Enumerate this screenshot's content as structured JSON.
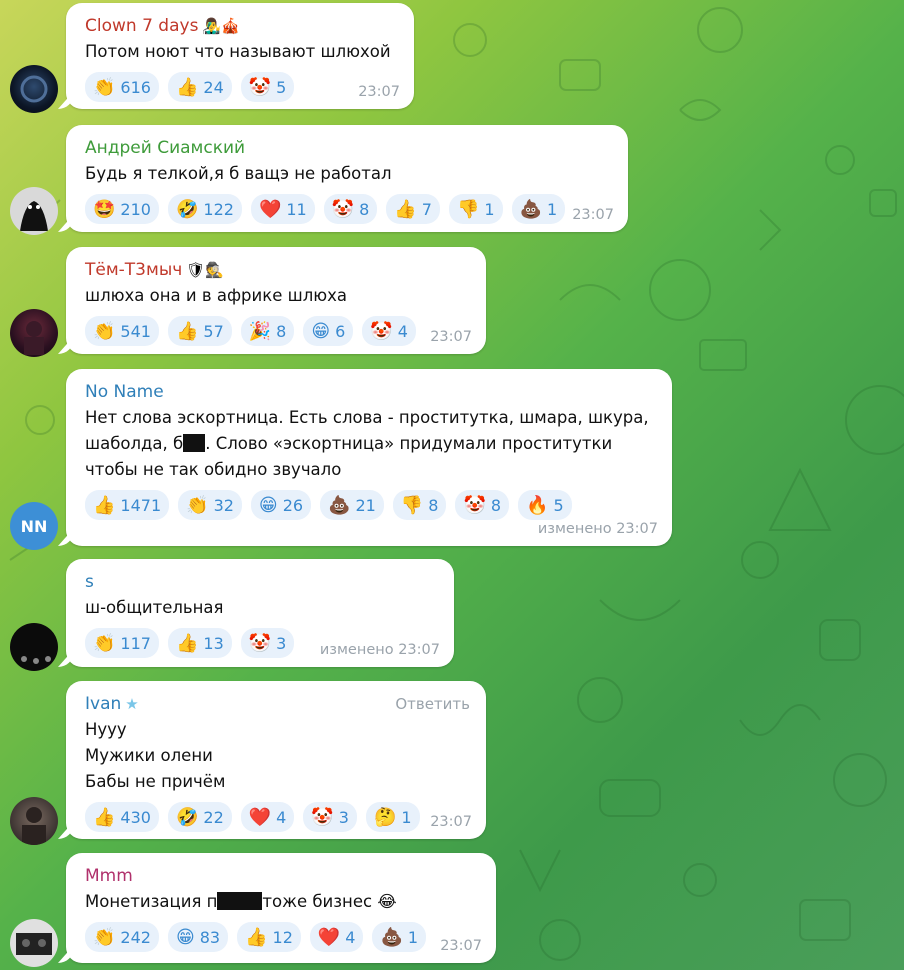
{
  "messages": [
    {
      "name": "Clown 7 days",
      "name_color": "#c0392b",
      "badge": "👨‍🎤🎪",
      "lines": [
        "Потом ноют что называют шлюхой"
      ],
      "reactions": [
        {
          "emoji": "👏",
          "count": "616"
        },
        {
          "emoji": "👍",
          "count": "24"
        },
        {
          "emoji": "🤡",
          "count": "5"
        }
      ],
      "time": "23:07"
    },
    {
      "name": "Андрей Сиамский",
      "name_color": "#3e9b3a",
      "lines": [
        "Будь я телкой,я б ващэ не работал"
      ],
      "reactions": [
        {
          "emoji": "🤩",
          "count": "210"
        },
        {
          "emoji": "🤣",
          "count": "122"
        },
        {
          "emoji": "❤️",
          "count": "11"
        },
        {
          "emoji": "🤡",
          "count": "8"
        },
        {
          "emoji": "👍",
          "count": "7"
        },
        {
          "emoji": "👎",
          "count": "1"
        },
        {
          "emoji": "💩",
          "count": "1"
        }
      ],
      "time": "23:07"
    },
    {
      "name": "Тём-Т3мыч",
      "name_color": "#c0392b",
      "badge": "🛡🕵",
      "lines": [
        "шлюха она и в африке шлюха"
      ],
      "reactions": [
        {
          "emoji": "👏",
          "count": "541"
        },
        {
          "emoji": "👍",
          "count": "57"
        },
        {
          "emoji": "🎉",
          "count": "8"
        },
        {
          "emoji": "😁",
          "count": "6"
        },
        {
          "emoji": "🤡",
          "count": "4"
        }
      ],
      "time": "23:07"
    },
    {
      "name": "No Name",
      "name_color": "#2f7fb8",
      "line1": "Нет слова эскортница. Есть слова - проститутка, шмара, шкура,",
      "line2_a": "шаболда, б",
      "line2_b": ". Слово «эскортница» придумали проститутки",
      "line3": "чтобы не так обидно звучало",
      "reactions": [
        {
          "emoji": "👍",
          "count": "1471"
        },
        {
          "emoji": "👏",
          "count": "32"
        },
        {
          "emoji": "😁",
          "count": "26"
        },
        {
          "emoji": "💩",
          "count": "21"
        },
        {
          "emoji": "👎",
          "count": "8"
        },
        {
          "emoji": "🤡",
          "count": "8"
        },
        {
          "emoji": "🔥",
          "count": "5"
        }
      ],
      "time": "изменено 23:07",
      "avatar_initials": "NN"
    },
    {
      "name": "s",
      "name_color": "#2f7fb8",
      "lines": [
        "ш-общительная"
      ],
      "reactions": [
        {
          "emoji": "👏",
          "count": "117"
        },
        {
          "emoji": "👍",
          "count": "13"
        },
        {
          "emoji": "🤡",
          "count": "3"
        }
      ],
      "time": "изменено 23:07"
    },
    {
      "name": "Ivan",
      "name_color": "#2f7fb8",
      "badge": "★",
      "reply": "Ответить",
      "lines": [
        "Нууу",
        "Мужики олени",
        "Бабы не причём"
      ],
      "reactions": [
        {
          "emoji": "👍",
          "count": "430"
        },
        {
          "emoji": "🤣",
          "count": "22"
        },
        {
          "emoji": "❤️",
          "count": "4"
        },
        {
          "emoji": "🤡",
          "count": "3"
        },
        {
          "emoji": "🤔",
          "count": "1"
        }
      ],
      "time": "23:07"
    },
    {
      "name": "Mmm",
      "name_color": "#b0306b",
      "text_a": "Монетизация п",
      "text_b": "тоже бизнес",
      "text_emoji": "😂",
      "reactions": [
        {
          "emoji": "👏",
          "count": "242"
        },
        {
          "emoji": "😁",
          "count": "83"
        },
        {
          "emoji": "👍",
          "count": "12"
        },
        {
          "emoji": "❤️",
          "count": "4"
        },
        {
          "emoji": "💩",
          "count": "1"
        }
      ],
      "time": "23:07"
    }
  ]
}
